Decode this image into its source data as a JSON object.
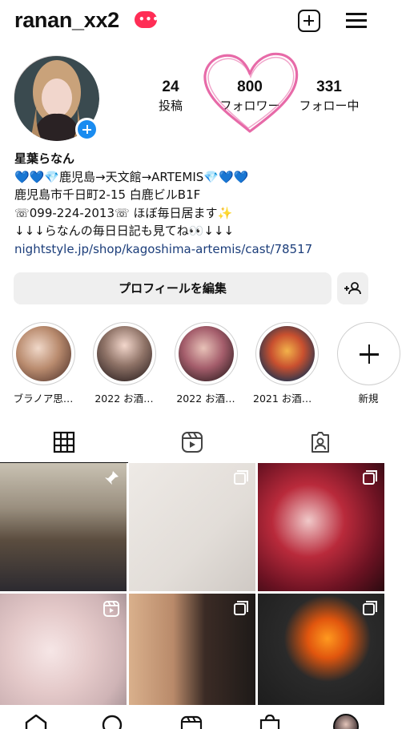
{
  "header": {
    "username": "ranan_xx2",
    "notification_badge": "•••",
    "icons": [
      "plus-square-icon",
      "menu-icon"
    ]
  },
  "profile": {
    "stats": [
      {
        "value": "24",
        "label": "投稿"
      },
      {
        "value": "800",
        "label": "フォロワー"
      },
      {
        "value": "331",
        "label": "フォロー中"
      }
    ],
    "name": "星葉らなん",
    "bio_lines": [
      "💙💙💎鹿児島→天文館→ARTEMIS💎💙💙",
      "鹿児島市千日町2-15 白鹿ビルB1F",
      "☏099-224-2013☏ ほぼ毎日居ます✨",
      "↓↓↓らなんの毎日日記も見てね👀↓↓↓"
    ],
    "link": "nightstyle.jp/shop/kagoshima-artemis/cast/78517"
  },
  "actions": {
    "edit_profile": "プロフィールを編集"
  },
  "highlights": [
    {
      "label": "ブラノア思…"
    },
    {
      "label": "2022 お酒…"
    },
    {
      "label": "2022 お酒…"
    },
    {
      "label": "2021 お酒物…"
    },
    {
      "label": "新規"
    }
  ],
  "tabs": [
    "grid-icon",
    "reels-icon",
    "tagged-icon"
  ],
  "colors": {
    "accent_blue": "#1a8cf0",
    "link": "#1b3d7a",
    "badge_red": "#ff2d55",
    "button_bg": "#efefef",
    "heart_pink": "#e76aa8"
  }
}
